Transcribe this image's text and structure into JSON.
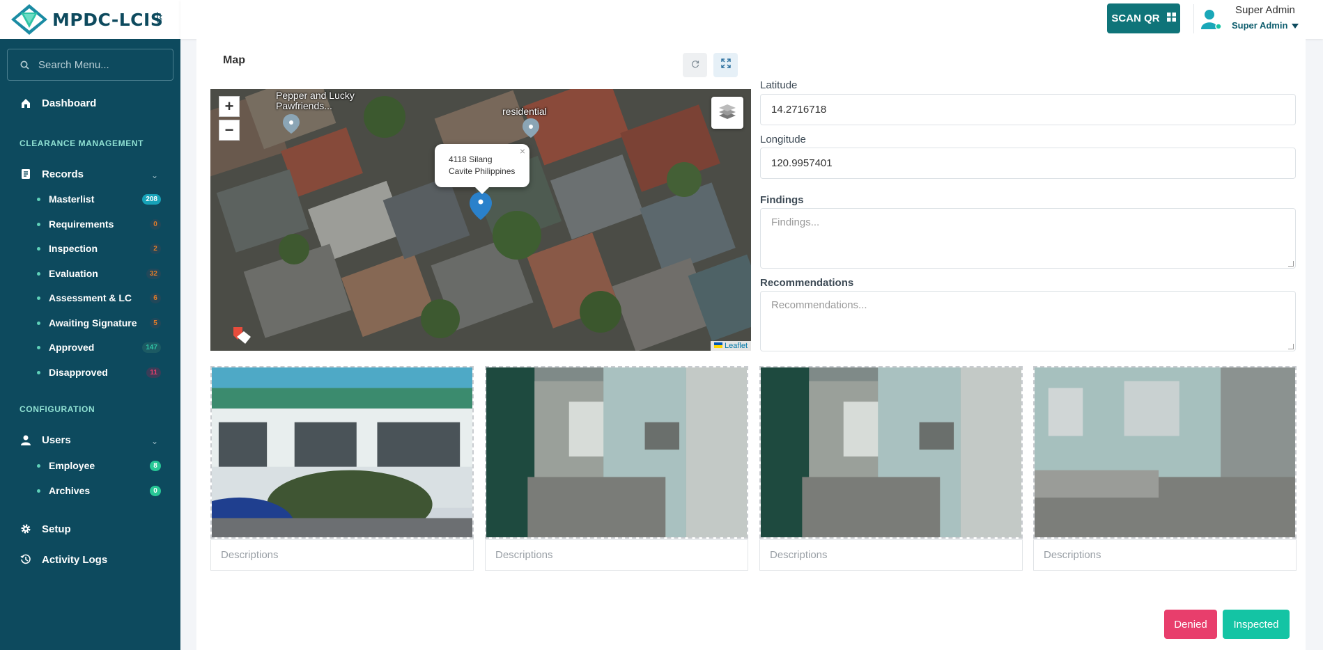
{
  "brand": {
    "name": "MPDC-LCIS",
    "logo_icon": "diamond-logo-icon",
    "collapse_icon": "collapse-left-icon"
  },
  "sidebar": {
    "search_placeholder": "Search Menu...",
    "dashboard": "Dashboard",
    "section_clearance": "CLEARANCE MANAGEMENT",
    "records": "Records",
    "records_items": [
      {
        "label": "Masterlist",
        "count": "208",
        "badge_color": "#17a2b8"
      },
      {
        "label": "Requirements",
        "count": "0",
        "badge_color": "#e07c2a"
      },
      {
        "label": "Inspection",
        "count": "2",
        "badge_color": "#e07c2a"
      },
      {
        "label": "Evaluation",
        "count": "32",
        "badge_color": "#e07c2a"
      },
      {
        "label": "Assessment & LC",
        "count": "6",
        "badge_color": "#e07c2a"
      },
      {
        "label": "Awaiting Signature",
        "count": "5",
        "badge_color": "#e07c2a"
      },
      {
        "label": "Approved",
        "count": "147",
        "badge_color": "#2ec4a6"
      },
      {
        "label": "Disapproved",
        "count": "11",
        "badge_color": "#e83e6c"
      }
    ],
    "section_config": "CONFIGURATION",
    "users": "Users",
    "users_items": [
      {
        "label": "Employee",
        "count": "8",
        "badge_color": "#28c796"
      },
      {
        "label": "Archives",
        "count": "0",
        "badge_color": "#28c796"
      }
    ],
    "setup": "Setup",
    "activity_logs": "Activity Logs"
  },
  "header": {
    "scan_label": "SCAN QR",
    "user_name": "Super Admin",
    "user_role": "Super Admin"
  },
  "map": {
    "title": "Map",
    "popup_line1": "4118 Silang",
    "popup_line2": "Cavite Philippines",
    "label_pepper_1": "Pepper and Lucky",
    "label_pepper_2": "Pawfriends...",
    "label_residential": "residential",
    "attribution": "Leaflet"
  },
  "form": {
    "latitude_label": "Latitude",
    "latitude_value": "14.2716718",
    "longitude_label": "Longitude",
    "longitude_value": "120.9957401",
    "findings_label": "Findings",
    "findings_placeholder": "Findings...",
    "recommendations_label": "Recommendations",
    "recommendations_placeholder": "Recommendations..."
  },
  "photos": [
    {
      "description_placeholder": "Descriptions"
    },
    {
      "description_placeholder": "Descriptions"
    },
    {
      "description_placeholder": "Descriptions"
    },
    {
      "description_placeholder": "Descriptions"
    }
  ],
  "actions": {
    "denied_label": "Denied",
    "denied_color": "#e83e6c",
    "inspected_label": "Inspected",
    "inspected_color": "#14c4a4"
  }
}
